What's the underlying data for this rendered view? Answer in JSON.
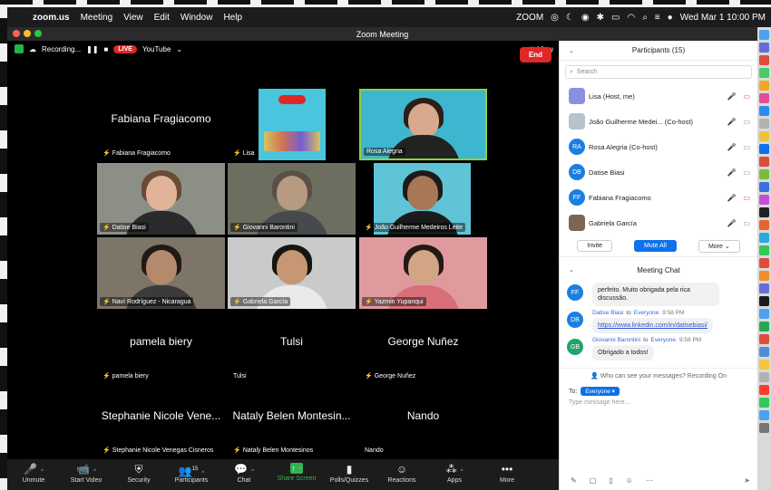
{
  "menubar": {
    "app": "zoom.us",
    "items": [
      "Meeting",
      "View",
      "Edit",
      "Window",
      "Help"
    ],
    "brand": "ZOOM",
    "clock": "Wed Mar 1  10:00 PM"
  },
  "window": {
    "title": "Zoom Meeting"
  },
  "topbar": {
    "recording": "Recording...",
    "live": "LIVE",
    "youtube": "YouTube",
    "view": "View"
  },
  "tiles": [
    {
      "name": "Fabiana Fragiacomo",
      "label": "Fabiana Fragiacomo",
      "muted": true,
      "video": false
    },
    {
      "name": "",
      "label": "Lisa",
      "muted": true,
      "video": true,
      "kind": "poster"
    },
    {
      "name": "",
      "label": "Rosa Alegria",
      "muted": false,
      "video": true,
      "kind": "poster2",
      "active": true
    },
    {
      "name": "",
      "label": "Datise Biasi",
      "muted": true,
      "video": true,
      "kind": "person",
      "skin": "#e1b49a",
      "hair": "#6b4a36",
      "shirt": "#2a2a2a",
      "bg": "#8c8f86"
    },
    {
      "name": "",
      "label": "Giovanni Barontini",
      "muted": true,
      "video": true,
      "kind": "person",
      "skin": "#b79a82",
      "hair": "#5a5048",
      "shirt": "#474a4d",
      "bg": "#6c6f60"
    },
    {
      "name": "",
      "label": "João Guilherme Medeiros Leite",
      "muted": true,
      "video": true,
      "kind": "poster3",
      "skin": "#a77756",
      "hair": "#1f1a17",
      "shirt": "#1b1b1b",
      "bg": "#5ec4d6"
    },
    {
      "name": "",
      "label": "Naví Rodríguez - Nicaragua",
      "muted": true,
      "video": true,
      "kind": "person",
      "skin": "#b58a6c",
      "hair": "#201a16",
      "shirt": "#3b3b3b",
      "bg": "#7c7568"
    },
    {
      "name": "",
      "label": "Gabriela García",
      "muted": true,
      "video": true,
      "kind": "person",
      "skin": "#c79774",
      "hair": "#181411",
      "shirt": "#eaeaea",
      "bg": "#c8cbca"
    },
    {
      "name": "",
      "label": "Yazmin Yupanqui",
      "muted": true,
      "video": true,
      "kind": "person",
      "skin": "#d4a487",
      "hair": "#231a14",
      "shirt": "#d86f78",
      "bg": "#e09a9e"
    },
    {
      "name": "pamela biery",
      "label": "pamela biery",
      "muted": true,
      "video": false
    },
    {
      "name": "Tulsi",
      "label": "Tulsi",
      "muted": false,
      "video": false
    },
    {
      "name": "George Nuñez",
      "label": "George Nuñez",
      "muted": true,
      "video": false
    },
    {
      "name": "Stephanie Nicole Vene...",
      "label": "Stephanie Nicole Venegas Cisneros",
      "muted": true,
      "video": false
    },
    {
      "name": "Nataly Belen Montesin...",
      "label": "Nataly Belen Montesinos",
      "muted": true,
      "video": false
    },
    {
      "name": "Nando",
      "label": "Nando",
      "muted": false,
      "video": false
    }
  ],
  "controls": [
    {
      "id": "unmute",
      "label": "Unmute",
      "icon": "mic-off-icon",
      "glyph": "🎤",
      "caret": true
    },
    {
      "id": "start-video",
      "label": "Start Video",
      "icon": "video-off-icon",
      "glyph": "📹",
      "caret": true
    },
    {
      "id": "security",
      "label": "Security",
      "icon": "shield-icon",
      "glyph": "⛨",
      "caret": false
    },
    {
      "id": "participants",
      "label": "Participants",
      "icon": "participants-icon",
      "glyph": "👥",
      "count": "15",
      "caret": true
    },
    {
      "id": "chat",
      "label": "Chat",
      "icon": "chat-icon",
      "glyph": "💬",
      "caret": true
    },
    {
      "id": "share-screen",
      "label": "Share Screen",
      "icon": "share-screen-icon",
      "glyph": "↑",
      "caret": true
    },
    {
      "id": "polls",
      "label": "Polls/Quizzes",
      "icon": "polls-icon",
      "glyph": "▮",
      "caret": false
    },
    {
      "id": "reactions",
      "label": "Reactions",
      "icon": "reactions-icon",
      "glyph": "☺",
      "caret": false
    },
    {
      "id": "apps",
      "label": "Apps",
      "icon": "apps-icon",
      "glyph": "⁂",
      "caret": true
    },
    {
      "id": "more",
      "label": "More",
      "icon": "more-icon",
      "glyph": "•••",
      "caret": false
    }
  ],
  "end_label": "End",
  "participants": {
    "title": "Participants (15)",
    "search_placeholder": "Search",
    "list": [
      {
        "name": "Lisa (Host, me)",
        "initials": "",
        "color": "#8a8fe0"
      },
      {
        "name": "João Guilherme Medei... (Co-host)",
        "initials": "",
        "color": "#b5c4cf"
      },
      {
        "name": "Rosa Alegria (Co-host)",
        "initials": "RA",
        "color": "#1a7fe0"
      },
      {
        "name": "Datise Biasi",
        "initials": "DB",
        "color": "#1a7fe0"
      },
      {
        "name": "Fabiana Fragiacomo",
        "initials": "FF",
        "color": "#1a7fe0"
      },
      {
        "name": "Gabriela García",
        "initials": "",
        "color": "#7e6553"
      }
    ],
    "buttons": {
      "invite": "Invite",
      "mute_all": "Mute All",
      "more": "More"
    }
  },
  "chat": {
    "title": "Meeting Chat",
    "messages": [
      {
        "initials": "FF",
        "color": "#1a7fe0",
        "sender": "",
        "to": "",
        "time": "",
        "text": "perfeito. Muito obrigada pela rica discussão."
      },
      {
        "initials": "DB",
        "color": "#1a7fe0",
        "sender": "Datise Biasi",
        "to": "Everyone",
        "time": "9:58 PM",
        "text": "https://www.linkedin.com/in/datisebiasi/"
      },
      {
        "initials": "GB",
        "color": "#23a26a",
        "sender": "Giovanni Barontini",
        "to": "Everyone",
        "time": "9:58 PM",
        "text": "Obrigado a todos!"
      }
    ],
    "notice": "Who can see your messages? Recording On",
    "to_label": "To:",
    "to_target": "Everyone",
    "input_placeholder": "Type message here...",
    "to_word": "to"
  },
  "colors": {
    "accent": "#0e71eb",
    "live": "#e02727",
    "share": "#2fb350",
    "end": "#e02828",
    "active_speaker": "#8bd13f"
  }
}
